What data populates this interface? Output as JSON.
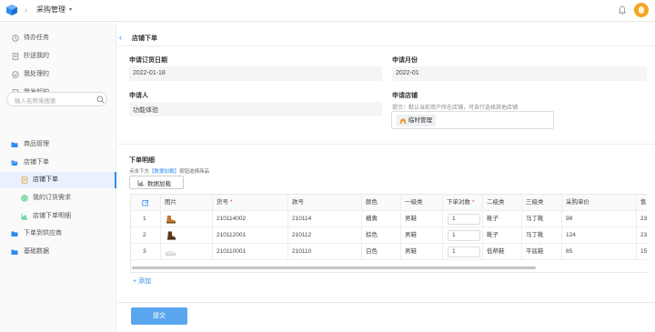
{
  "header": {
    "app_title": "采购管理",
    "separator": "›",
    "caret": "▾"
  },
  "sidebar": {
    "items_top": [
      {
        "label": "待办任务",
        "icon": "clock-icon"
      },
      {
        "label": "抄送我的",
        "icon": "document-icon"
      },
      {
        "label": "我处理的",
        "icon": "check-circle-icon"
      },
      {
        "label": "我发起的",
        "icon": "send-document-icon"
      }
    ],
    "search_placeholder": "输入名称来搜索",
    "groups": [
      {
        "label": "商品管理",
        "icon": "folder-icon"
      },
      {
        "label": "店铺下单",
        "icon": "folder-open-icon"
      }
    ],
    "sub_items": [
      {
        "label": "店铺下单",
        "icon": "form-icon",
        "active": true
      },
      {
        "label": "我的订货需求",
        "icon": "target-icon"
      },
      {
        "label": "店铺下单明细",
        "icon": "bar-chart-icon"
      }
    ],
    "groups_bottom": [
      {
        "label": "下单到供应商",
        "icon": "folder-icon"
      },
      {
        "label": "基础数据",
        "icon": "folder-icon"
      }
    ],
    "accent": "#2d8cf0"
  },
  "form": {
    "title": "店铺下单",
    "order_date_label": "申请订货日期",
    "order_date_value": "2022-01-18",
    "order_month_label": "申请月份",
    "order_month_value": "2022-01",
    "applicant_label": "申请人",
    "applicant_value": "功能体验",
    "store_label": "申请店铺",
    "store_hint": "提示：默认当前用户所在店铺，可自行选择其他店铺",
    "store_tag": "临时管理"
  },
  "detail": {
    "title": "下单明细",
    "hint_prefix": "点击下方",
    "hint_link": "【数据加载】",
    "hint_suffix": "按钮选择商品",
    "load_button": "数据加载",
    "columns": [
      "",
      "图片",
      "货号",
      "款号",
      "颜色",
      "一级类",
      "下单对数",
      "二级类",
      "三级类",
      "采购单价",
      "售"
    ],
    "required_cols": [
      2,
      6
    ],
    "rows": [
      {
        "no": "1",
        "sku": "210114002",
        "style": "210114",
        "color": "橘黄",
        "cat1": "男鞋",
        "qty": "1",
        "cat2": "靴子",
        "cat3": "马丁靴",
        "price": "98",
        "sale": "23"
      },
      {
        "no": "2",
        "sku": "210112001",
        "style": "210112",
        "color": "棕色",
        "cat1": "男鞋",
        "qty": "1",
        "cat2": "靴子",
        "cat3": "马丁靴",
        "price": "124",
        "sale": "23"
      },
      {
        "no": "3",
        "sku": "210110001",
        "style": "210110",
        "color": "白色",
        "cat1": "男鞋",
        "qty": "1",
        "cat2": "低帮鞋",
        "cat3": "平底鞋",
        "price": "85",
        "sale": "15"
      }
    ],
    "add_link": "+ 添加"
  },
  "footer": {
    "submit": "提交"
  }
}
